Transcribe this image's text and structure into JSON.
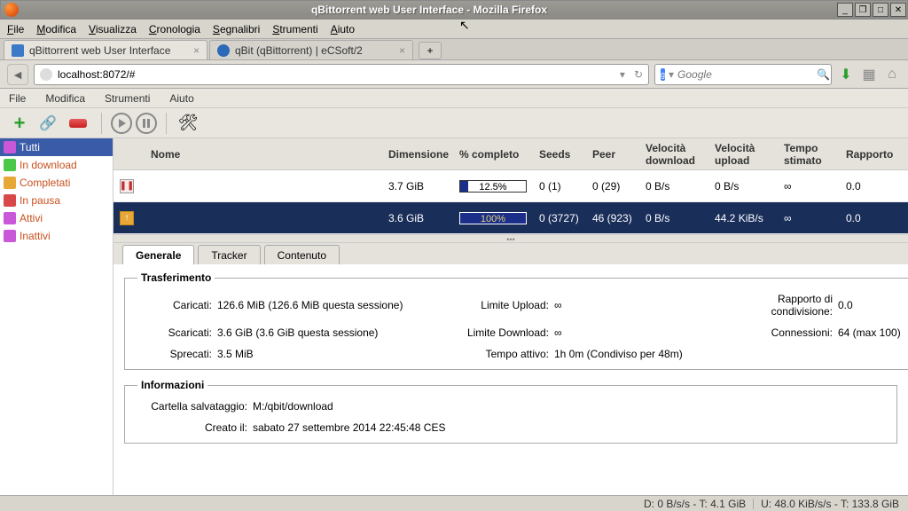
{
  "window": {
    "title": "qBittorrent web User Interface - Mozilla Firefox"
  },
  "firefox_menu": {
    "file": "File",
    "edit": "Modifica",
    "view": "Visualizza",
    "history": "Cronologia",
    "bookmarks": "Segnalibri",
    "tools": "Strumenti",
    "help": "Aiuto"
  },
  "tabs": {
    "tab1": "qBittorrent web User Interface",
    "tab2": "qBit (qBittorrent) | eCSoft/2"
  },
  "url": "localhost:8072/#",
  "search_placeholder": "Google",
  "app_menu": {
    "file": "File",
    "edit": "Modifica",
    "tools": "Strumenti",
    "help": "Aiuto"
  },
  "sidebar": {
    "all": "Tutti",
    "downloading": "In download",
    "completed": "Completati",
    "paused": "In pausa",
    "active": "Attivi",
    "inactive": "Inattivi"
  },
  "columns": {
    "name": "Nome",
    "size": "Dimensione",
    "progress": "% completo",
    "seeds": "Seeds",
    "peer": "Peer",
    "dlspeed": "Velocità download",
    "ulspeed": "Velocità upload",
    "eta": "Tempo stimato",
    "ratio": "Rapporto"
  },
  "torrents": [
    {
      "size": "3.7 GiB",
      "progress_pct": 12.5,
      "progress_text": "12.5%",
      "seeds": "0 (1)",
      "peers": "0 (29)",
      "dl": "0 B/s",
      "ul": "0 B/s",
      "eta": "∞",
      "ratio": "0.0"
    },
    {
      "size": "3.6 GiB",
      "progress_pct": 100,
      "progress_text": "100%",
      "seeds": "0 (3727)",
      "peers": "46 (923)",
      "dl": "0 B/s",
      "ul": "44.2 KiB/s",
      "eta": "∞",
      "ratio": "0.0"
    }
  ],
  "detail_tabs": {
    "general": "Generale",
    "tracker": "Tracker",
    "content": "Contenuto"
  },
  "transfer": {
    "legend": "Trasferimento",
    "uploaded_lbl": "Caricati:",
    "uploaded_val": "126.6 MiB (126.6 MiB questa sessione)",
    "uplimit_lbl": "Limite Upload:",
    "uplimit_val": "∞",
    "ratio_lbl": "Rapporto di condivisione:",
    "ratio_val": "0.0",
    "downloaded_lbl": "Scaricati:",
    "downloaded_val": "3.6 GiB (3.6 GiB questa sessione)",
    "dllimit_lbl": "Limite Download:",
    "dllimit_val": "∞",
    "conn_lbl": "Connessioni:",
    "conn_val": "64 (max 100)",
    "wasted_lbl": "Sprecati:",
    "wasted_val": "3.5 MiB",
    "active_lbl": "Tempo attivo:",
    "active_val": "1h 0m (Condiviso per 48m)"
  },
  "info": {
    "legend": "Informazioni",
    "path_lbl": "Cartella salvataggio:",
    "path_val": "M:/qbit/download",
    "created_lbl": "Creato il:",
    "created_val": "sabato 27 settembre 2014 22:45:48 CES"
  },
  "statusbar": {
    "dl": "D: 0 B/s/s - T: 4.1 GiB",
    "ul": "U: 48.0 KiB/s/s - T: 133.8 GiB"
  }
}
